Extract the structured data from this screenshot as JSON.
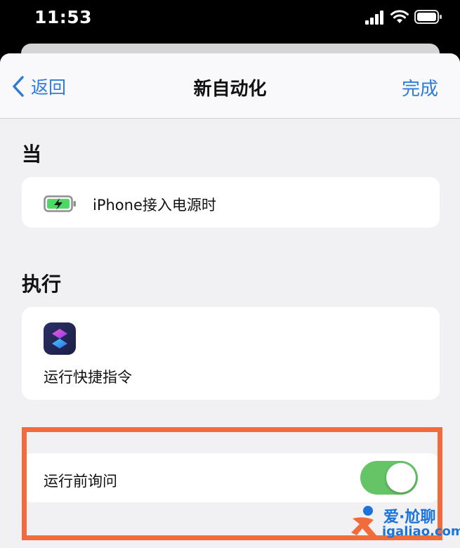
{
  "status_bar": {
    "time": "11:53"
  },
  "nav": {
    "back_label": "返回",
    "title": "新自动化",
    "done_label": "完成"
  },
  "when": {
    "section_title": "当",
    "trigger_label": "iPhone接入电源时",
    "trigger_icon": "battery-charging-icon"
  },
  "do": {
    "section_title": "执行",
    "action_label": "运行快捷指令",
    "action_icon": "shortcuts-app-icon"
  },
  "ask_before_running": {
    "label": "运行前询问",
    "enabled": true
  },
  "colors": {
    "accent": "#2f7bd8",
    "toggle_on": "#65c466",
    "highlight": "#f26b3a",
    "background": "#f1f1f4"
  },
  "watermark": {
    "text": "爱·尬聊",
    "url": "igaliao.com"
  }
}
